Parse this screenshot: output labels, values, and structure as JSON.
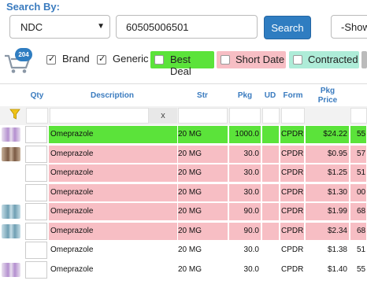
{
  "search": {
    "title": "Search By:",
    "type_value": "NDC",
    "query_value": "60505006501",
    "button_label": "Search",
    "show_value": "-Show"
  },
  "cart": {
    "count": "204"
  },
  "filters": {
    "brand": "Brand",
    "generic": "Generic",
    "best_deal": "Best Deal",
    "short_date": "Short Date",
    "contracted": "Contracted"
  },
  "columns": {
    "qty": "Qty",
    "description": "Description",
    "str": "Str",
    "pkg": "Pkg",
    "ud": "UD",
    "form": "Form",
    "pkg_price_1": "Pkg",
    "pkg_price_2": "Price"
  },
  "filter_clear": "x",
  "colors": {
    "best_deal": "#5be33a",
    "short_date": "#f7bec4",
    "contracted": "#aeecd8",
    "accent": "#2f7dc1"
  },
  "rows": [
    {
      "desc": "Omeprazole",
      "str": "20 MG",
      "pkg": "1000.0",
      "form": "CPDR",
      "price": "$24.22",
      "extra": "55",
      "type": "best"
    },
    {
      "desc": "Omeprazole",
      "str": "20 MG",
      "pkg": "30.0",
      "form": "CPDR",
      "price": "$0.95",
      "extra": "57",
      "type": "short"
    },
    {
      "desc": "Omeprazole",
      "str": "20 MG",
      "pkg": "30.0",
      "form": "CPDR",
      "price": "$1.25",
      "extra": "51",
      "type": "short"
    },
    {
      "desc": "Omeprazole",
      "str": "20 MG",
      "pkg": "30.0",
      "form": "CPDR",
      "price": "$1.30",
      "extra": "00",
      "type": "short"
    },
    {
      "desc": "Omeprazole",
      "str": "20 MG",
      "pkg": "90.0",
      "form": "CPDR",
      "price": "$1.99",
      "extra": "68",
      "type": "short"
    },
    {
      "desc": "Omeprazole",
      "str": "20 MG",
      "pkg": "90.0",
      "form": "CPDR",
      "price": "$2.34",
      "extra": "68",
      "type": "short"
    },
    {
      "desc": "Omeprazole",
      "str": "20 MG",
      "pkg": "30.0",
      "form": "CPDR",
      "price": "$1.38",
      "extra": "51",
      "type": "none"
    },
    {
      "desc": "Omeprazole",
      "str": "20 MG",
      "pkg": "30.0",
      "form": "CPDR",
      "price": "$1.40",
      "extra": "55",
      "type": "none"
    }
  ],
  "row_images": [
    "capsule-purple-icon",
    "capsule-brown-icon",
    "",
    "",
    "capsule-blue-icon",
    "capsule-blue-icon",
    "",
    "capsule-purple-icon"
  ]
}
